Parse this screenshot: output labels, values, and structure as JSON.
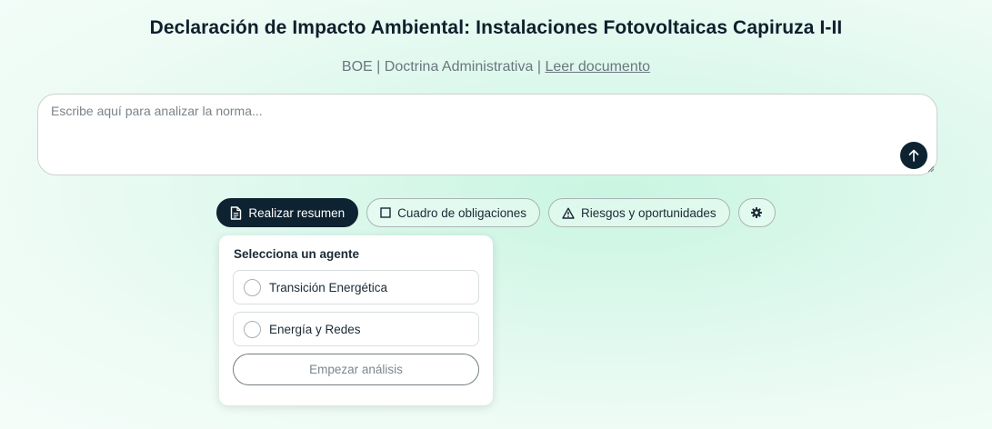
{
  "header": {
    "title": "Declaración de Impacto Ambiental: Instalaciones Fotovoltaicas Capiruza I-II",
    "source": "BOE",
    "separator": " | ",
    "category": "Doctrina Administrativa",
    "link_label": "Leer documento"
  },
  "composer": {
    "placeholder": "Escribe aquí para analizar la norma...",
    "value": "",
    "send_icon": "arrow-up-icon"
  },
  "actions": [
    {
      "label": "Realizar resumen",
      "icon": "document-icon",
      "active": true
    },
    {
      "label": "Cuadro de obligaciones",
      "icon": "square-icon",
      "active": false
    },
    {
      "label": "Riesgos y oportunidades",
      "icon": "warning-icon",
      "active": false
    },
    {
      "label": "",
      "icon": "gear-icon",
      "active": false
    }
  ],
  "agent_menu": {
    "title": "Selecciona un agente",
    "options": [
      {
        "label": "Transición Energética",
        "selected": false
      },
      {
        "label": "Energía y Redes",
        "selected": false
      }
    ],
    "start_label": "Empezar análisis"
  },
  "colors": {
    "dark_accent": "#0e2331",
    "background_tint": "#dcf8ec"
  }
}
